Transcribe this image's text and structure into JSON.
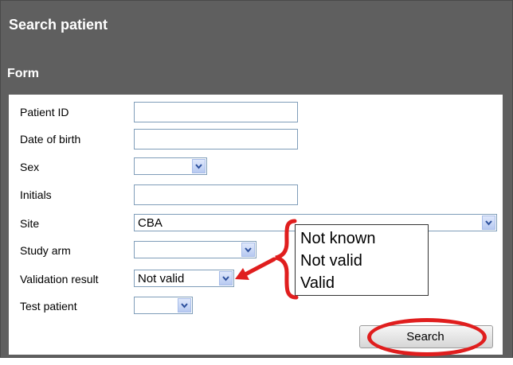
{
  "header": {
    "title": "Search patient"
  },
  "form": {
    "section_title": "Form",
    "fields": {
      "patient_id": {
        "label": "Patient ID",
        "value": ""
      },
      "date_of_birth": {
        "label": "Date of birth",
        "value": ""
      },
      "sex": {
        "label": "Sex",
        "value": ""
      },
      "initials": {
        "label": "Initials",
        "value": ""
      },
      "site": {
        "label": "Site",
        "value": "CBA"
      },
      "study_arm": {
        "label": "Study arm",
        "value": ""
      },
      "validation_result": {
        "label": "Validation result",
        "value": "Not valid",
        "options": [
          "Not known",
          "Not valid",
          "Valid"
        ]
      },
      "test_patient": {
        "label": "Test patient",
        "value": ""
      }
    },
    "search_label": "Search"
  },
  "annotations": {
    "accent_color": "#e01e1e"
  }
}
